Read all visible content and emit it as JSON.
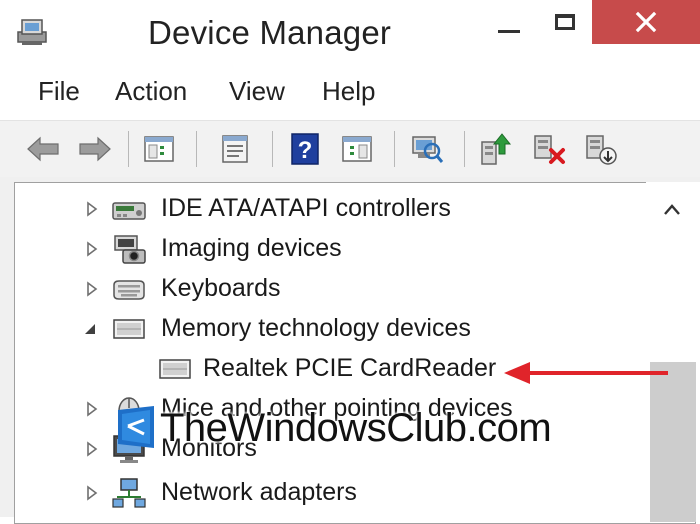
{
  "window": {
    "title": "Device Manager"
  },
  "menu": {
    "items": [
      "File",
      "Action",
      "View",
      "Help"
    ]
  },
  "toolbar": {
    "buttons": [
      "back",
      "forward",
      "show-hide-console-tree",
      "properties",
      "help",
      "action-pane",
      "scan-hardware-changes",
      "update-driver",
      "disable-device",
      "uninstall-device"
    ]
  },
  "tree": {
    "rows": [
      {
        "label": "IDE ATA/ATAPI controllers",
        "state": "collapsed",
        "icon": "ide-controller-icon"
      },
      {
        "label": "Imaging devices",
        "state": "collapsed",
        "icon": "camera-icon"
      },
      {
        "label": "Keyboards",
        "state": "collapsed",
        "icon": "keyboard-icon"
      },
      {
        "label": "Memory technology devices",
        "state": "expanded",
        "icon": "memory-device-icon"
      },
      {
        "label": "Realtek PCIE CardReader",
        "state": "child",
        "icon": "memory-device-icon"
      },
      {
        "label": "Mice and other pointing devices",
        "state": "collapsed",
        "icon": "mouse-icon"
      },
      {
        "label": "Monitors",
        "state": "collapsed",
        "icon": "monitor-icon"
      },
      {
        "label": "Network adapters",
        "state": "collapsed",
        "icon": "network-icon"
      }
    ]
  },
  "annotation": {
    "arrow_color": "#e0242a"
  },
  "watermark": {
    "text": "TheWindowsClub.com"
  },
  "colors": {
    "close_button": "#c74b4b",
    "selection_accent": "#3c78c8"
  }
}
